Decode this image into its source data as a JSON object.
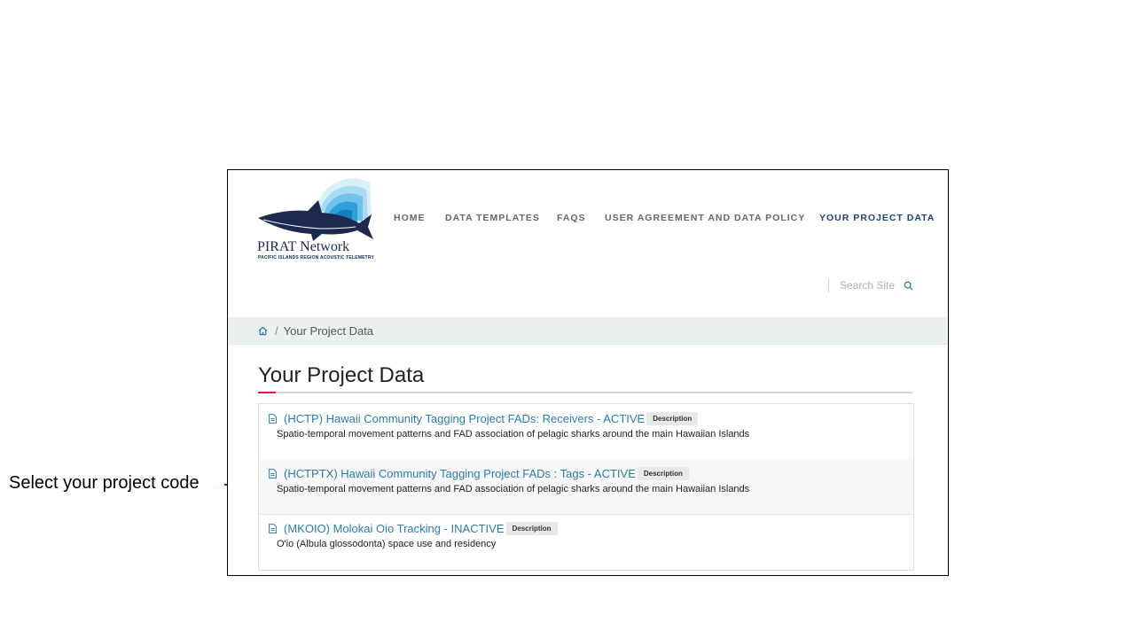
{
  "annotation": {
    "text": "Select your project code"
  },
  "logo": {
    "title": "PIRAT Network",
    "subtitle": "PACIFIC ISLANDS REGION ACOUSTIC TELEMETRY"
  },
  "nav": {
    "items": [
      {
        "label": "HOME"
      },
      {
        "label": "DATA TEMPLATES"
      },
      {
        "label": "FAQS"
      },
      {
        "label": "USER AGREEMENT AND DATA POLICY"
      },
      {
        "label": "YOUR PROJECT DATA",
        "active": true
      }
    ]
  },
  "search": {
    "placeholder": "Search Site"
  },
  "breadcrumb": {
    "separator": "/",
    "current": "Your Project Data"
  },
  "page": {
    "title": "Your Project Data"
  },
  "projects": [
    {
      "title": "(HCTP) Hawaii Community Tagging Project FADs: Receivers - ACTIVE",
      "badge": "Description",
      "description": "Spatio-temporal movement patterns and FAD association of pelagic sharks around the main Hawaiian Islands"
    },
    {
      "title": "(HCTPTX) Hawaii Community Tagging Project FADs : Tags - ACTIVE",
      "badge": "Description",
      "description": "Spatio-temporal movement patterns and FAD association of pelagic sharks around the main Hawaiian Islands"
    },
    {
      "title": "(MKOIO) Molokai Oio Tracking - INACTIVE",
      "badge": "Description",
      "description": "O'io (Albula glossodonta) space use and residency"
    }
  ],
  "colors": {
    "link": "#2a7da8",
    "nav_active": "#1e3f7a",
    "accent": "#e31a4e",
    "annotation_bracket": "#c00000"
  }
}
